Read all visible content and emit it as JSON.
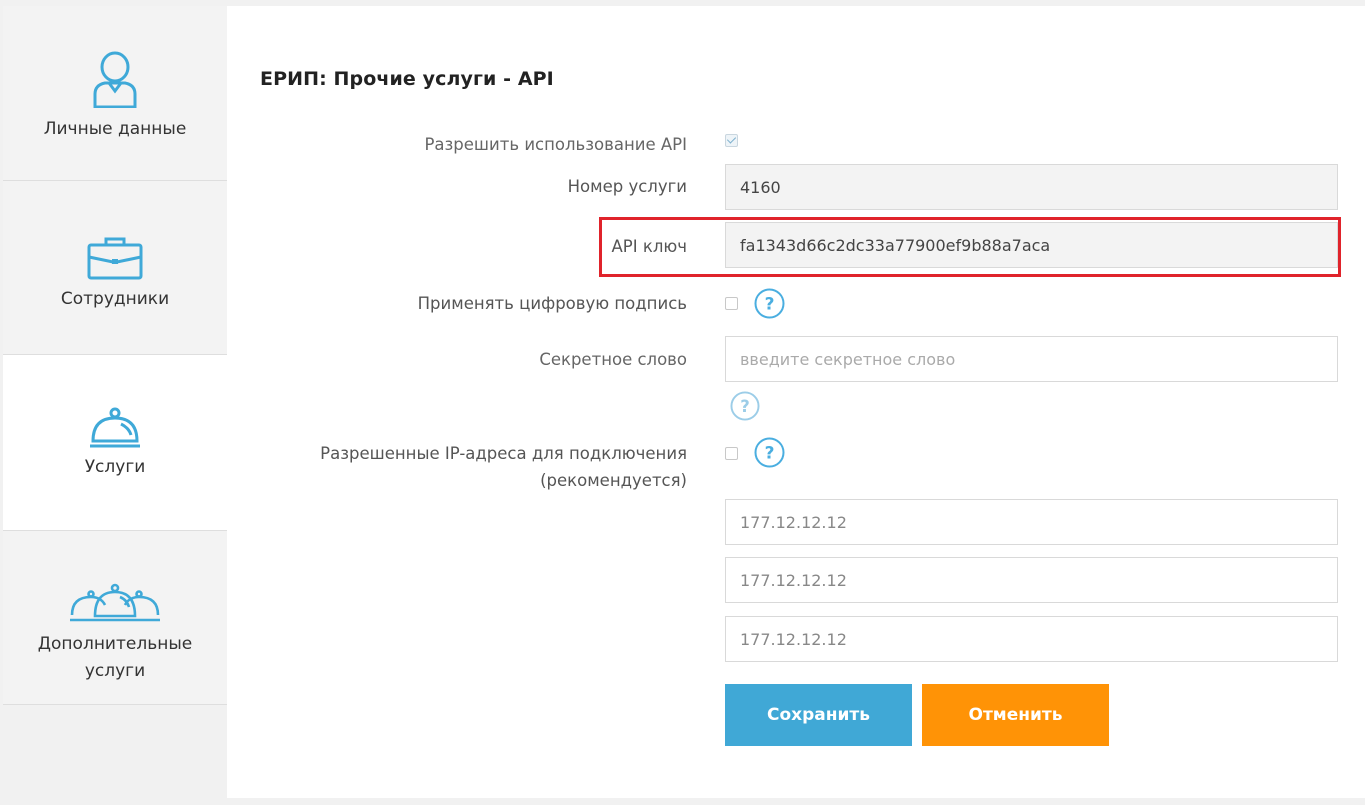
{
  "sidebar": {
    "items": [
      {
        "label": "Личные данные",
        "icon": "user-icon",
        "active": false
      },
      {
        "label": "Сотрудники",
        "icon": "briefcase-icon",
        "active": false
      },
      {
        "label": "Услуги",
        "icon": "service-bell-icon",
        "active": true
      },
      {
        "label_line1": "Дополнительные",
        "label_line2": "услуги",
        "icon": "multiple-bells-icon",
        "active": false
      }
    ]
  },
  "main": {
    "title": "ЕРИП: Прочие услуги - API",
    "fields": {
      "allow_api": {
        "label": "Разрешить использование API",
        "checked": true
      },
      "service_number": {
        "label": "Номер услуги",
        "value": "4160"
      },
      "api_key": {
        "label": "API ключ",
        "value": "fa1343d66c2dc33a77900ef9b88a7aca"
      },
      "digital_signature": {
        "label": "Применять цифровую подпись",
        "checked": false
      },
      "secret_word": {
        "label": "Секретное слово",
        "placeholder": "введите секретное слово",
        "value": ""
      },
      "allowed_ips": {
        "label_line1": "Разрешенные IP-адреса для подключения",
        "label_line2": "(рекомендуется)",
        "checked": false,
        "values": [
          "177.12.12.12",
          "177.12.12.12",
          "177.12.12.12"
        ]
      }
    },
    "buttons": {
      "save": "Сохранить",
      "cancel": "Отменить"
    }
  },
  "colors": {
    "accent": "#40a8d6",
    "cancel": "#ff9306",
    "highlight": "#e0232b",
    "icon": "#3fa9d8"
  }
}
